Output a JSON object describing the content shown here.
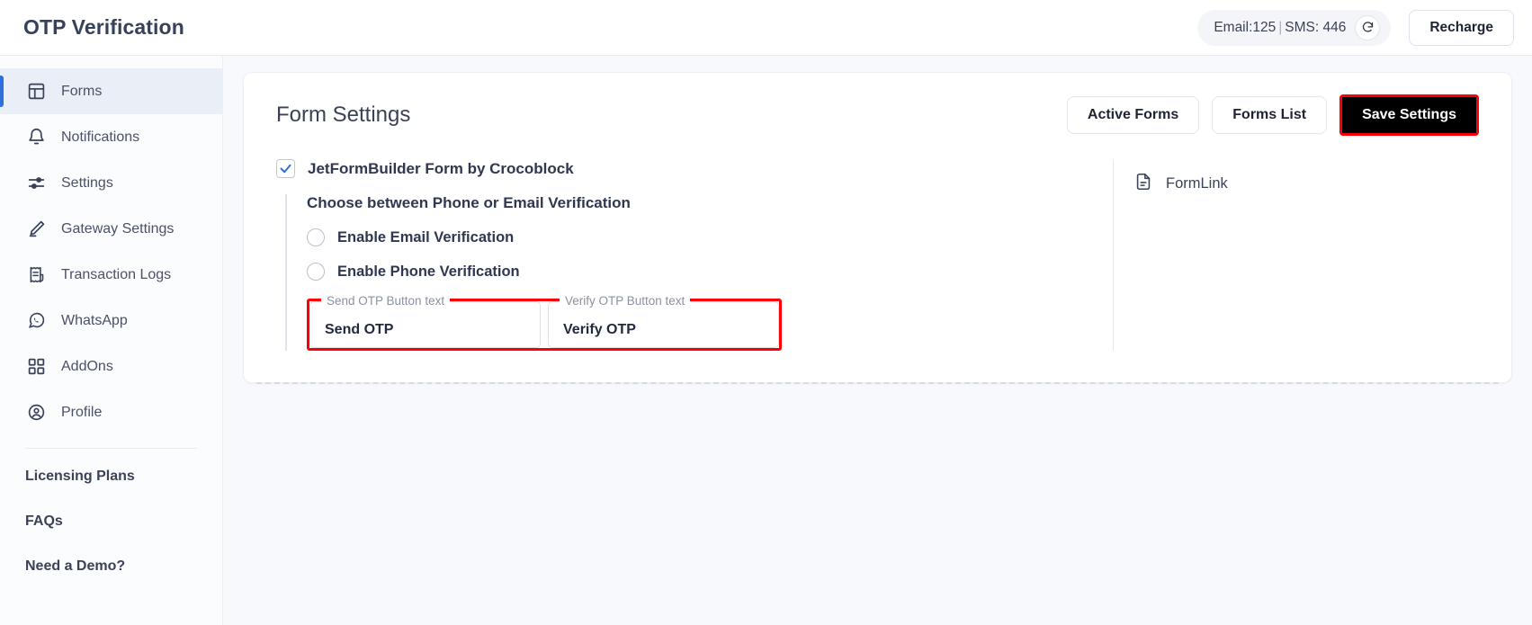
{
  "topbar": {
    "title": "OTP Verification",
    "credits": {
      "email_label": "Email:125",
      "separator": "|",
      "sms_label": "SMS: 446",
      "refresh_icon": "refresh-icon"
    },
    "recharge_label": "Recharge"
  },
  "sidebar": {
    "items": [
      {
        "label": "Forms",
        "icon": "layout-grid-icon",
        "active": true
      },
      {
        "label": "Notifications",
        "icon": "bell-icon",
        "active": false
      },
      {
        "label": "Settings",
        "icon": "sliders-icon",
        "active": false
      },
      {
        "label": "Gateway Settings",
        "icon": "brush-icon",
        "active": false
      },
      {
        "label": "Transaction Logs",
        "icon": "receipt-icon",
        "active": false
      },
      {
        "label": "WhatsApp",
        "icon": "whatsapp-icon",
        "active": false
      },
      {
        "label": "AddOns",
        "icon": "grid-squares-icon",
        "active": false
      },
      {
        "label": "Profile",
        "icon": "user-circle-icon",
        "active": false
      }
    ],
    "links": [
      {
        "label": "Licensing Plans"
      },
      {
        "label": "FAQs"
      },
      {
        "label": "Need a Demo?"
      }
    ]
  },
  "main": {
    "card_title": "Form Settings",
    "actions": {
      "active_forms": "Active Forms",
      "forms_list": "Forms List",
      "save_settings": "Save Settings"
    },
    "form": {
      "form_checkbox_label": "JetFormBuilder Form by Crocoblock",
      "form_checkbox_checked": true,
      "group_title": "Choose between Phone or Email Verification",
      "radios": [
        {
          "label": "Enable Email Verification",
          "selected": false
        },
        {
          "label": "Enable Phone Verification",
          "selected": false
        }
      ],
      "fields": [
        {
          "legend": "Send OTP Button text",
          "value": "Send OTP"
        },
        {
          "legend": "Verify OTP Button text",
          "value": "Verify OTP"
        }
      ]
    },
    "side": {
      "formlink_label": "FormLink",
      "formlink_icon": "document-icon"
    }
  },
  "colors": {
    "accent_blue": "#2f6fdd",
    "highlight_red": "#fb0007",
    "page_bg": "#f7f9fc",
    "text_dark": "#303750"
  }
}
